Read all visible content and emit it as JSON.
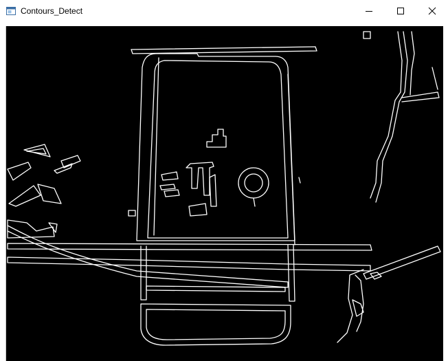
{
  "window": {
    "title": "Contours_Detect",
    "icon": "app-window-icon",
    "controls": {
      "minimize_icon": "minimize-icon",
      "maximize_icon": "maximize-icon",
      "close_icon": "close-icon"
    }
  },
  "canvas": {
    "description_icon": "contour-image",
    "background": "#000000",
    "stroke": "#ffffff"
  }
}
